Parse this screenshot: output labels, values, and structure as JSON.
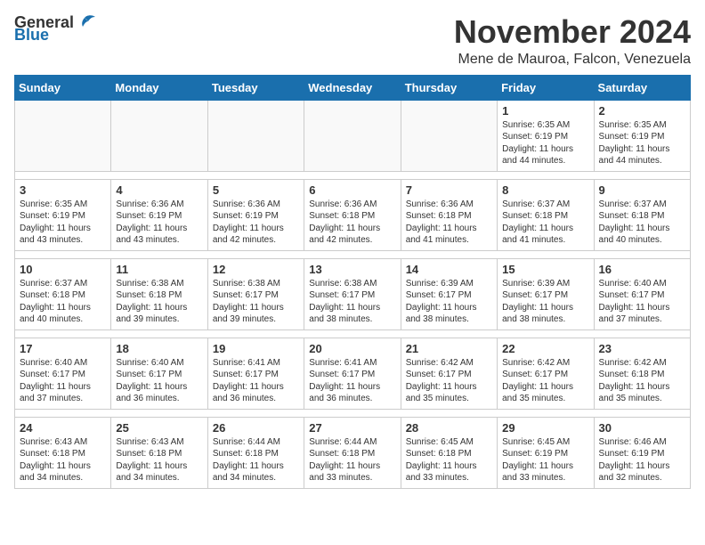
{
  "logo": {
    "general": "General",
    "blue": "Blue"
  },
  "header": {
    "month_title": "November 2024",
    "location": "Mene de Mauroa, Falcon, Venezuela"
  },
  "days_of_week": [
    "Sunday",
    "Monday",
    "Tuesday",
    "Wednesday",
    "Thursday",
    "Friday",
    "Saturday"
  ],
  "weeks": [
    [
      {
        "day": "",
        "info": ""
      },
      {
        "day": "",
        "info": ""
      },
      {
        "day": "",
        "info": ""
      },
      {
        "day": "",
        "info": ""
      },
      {
        "day": "",
        "info": ""
      },
      {
        "day": "1",
        "info": "Sunrise: 6:35 AM\nSunset: 6:19 PM\nDaylight: 11 hours and 44 minutes."
      },
      {
        "day": "2",
        "info": "Sunrise: 6:35 AM\nSunset: 6:19 PM\nDaylight: 11 hours and 44 minutes."
      }
    ],
    [
      {
        "day": "3",
        "info": "Sunrise: 6:35 AM\nSunset: 6:19 PM\nDaylight: 11 hours and 43 minutes."
      },
      {
        "day": "4",
        "info": "Sunrise: 6:36 AM\nSunset: 6:19 PM\nDaylight: 11 hours and 43 minutes."
      },
      {
        "day": "5",
        "info": "Sunrise: 6:36 AM\nSunset: 6:19 PM\nDaylight: 11 hours and 42 minutes."
      },
      {
        "day": "6",
        "info": "Sunrise: 6:36 AM\nSunset: 6:18 PM\nDaylight: 11 hours and 42 minutes."
      },
      {
        "day": "7",
        "info": "Sunrise: 6:36 AM\nSunset: 6:18 PM\nDaylight: 11 hours and 41 minutes."
      },
      {
        "day": "8",
        "info": "Sunrise: 6:37 AM\nSunset: 6:18 PM\nDaylight: 11 hours and 41 minutes."
      },
      {
        "day": "9",
        "info": "Sunrise: 6:37 AM\nSunset: 6:18 PM\nDaylight: 11 hours and 40 minutes."
      }
    ],
    [
      {
        "day": "10",
        "info": "Sunrise: 6:37 AM\nSunset: 6:18 PM\nDaylight: 11 hours and 40 minutes."
      },
      {
        "day": "11",
        "info": "Sunrise: 6:38 AM\nSunset: 6:18 PM\nDaylight: 11 hours and 39 minutes."
      },
      {
        "day": "12",
        "info": "Sunrise: 6:38 AM\nSunset: 6:17 PM\nDaylight: 11 hours and 39 minutes."
      },
      {
        "day": "13",
        "info": "Sunrise: 6:38 AM\nSunset: 6:17 PM\nDaylight: 11 hours and 38 minutes."
      },
      {
        "day": "14",
        "info": "Sunrise: 6:39 AM\nSunset: 6:17 PM\nDaylight: 11 hours and 38 minutes."
      },
      {
        "day": "15",
        "info": "Sunrise: 6:39 AM\nSunset: 6:17 PM\nDaylight: 11 hours and 38 minutes."
      },
      {
        "day": "16",
        "info": "Sunrise: 6:40 AM\nSunset: 6:17 PM\nDaylight: 11 hours and 37 minutes."
      }
    ],
    [
      {
        "day": "17",
        "info": "Sunrise: 6:40 AM\nSunset: 6:17 PM\nDaylight: 11 hours and 37 minutes."
      },
      {
        "day": "18",
        "info": "Sunrise: 6:40 AM\nSunset: 6:17 PM\nDaylight: 11 hours and 36 minutes."
      },
      {
        "day": "19",
        "info": "Sunrise: 6:41 AM\nSunset: 6:17 PM\nDaylight: 11 hours and 36 minutes."
      },
      {
        "day": "20",
        "info": "Sunrise: 6:41 AM\nSunset: 6:17 PM\nDaylight: 11 hours and 36 minutes."
      },
      {
        "day": "21",
        "info": "Sunrise: 6:42 AM\nSunset: 6:17 PM\nDaylight: 11 hours and 35 minutes."
      },
      {
        "day": "22",
        "info": "Sunrise: 6:42 AM\nSunset: 6:17 PM\nDaylight: 11 hours and 35 minutes."
      },
      {
        "day": "23",
        "info": "Sunrise: 6:42 AM\nSunset: 6:18 PM\nDaylight: 11 hours and 35 minutes."
      }
    ],
    [
      {
        "day": "24",
        "info": "Sunrise: 6:43 AM\nSunset: 6:18 PM\nDaylight: 11 hours and 34 minutes."
      },
      {
        "day": "25",
        "info": "Sunrise: 6:43 AM\nSunset: 6:18 PM\nDaylight: 11 hours and 34 minutes."
      },
      {
        "day": "26",
        "info": "Sunrise: 6:44 AM\nSunset: 6:18 PM\nDaylight: 11 hours and 34 minutes."
      },
      {
        "day": "27",
        "info": "Sunrise: 6:44 AM\nSunset: 6:18 PM\nDaylight: 11 hours and 33 minutes."
      },
      {
        "day": "28",
        "info": "Sunrise: 6:45 AM\nSunset: 6:18 PM\nDaylight: 11 hours and 33 minutes."
      },
      {
        "day": "29",
        "info": "Sunrise: 6:45 AM\nSunset: 6:19 PM\nDaylight: 11 hours and 33 minutes."
      },
      {
        "day": "30",
        "info": "Sunrise: 6:46 AM\nSunset: 6:19 PM\nDaylight: 11 hours and 32 minutes."
      }
    ]
  ]
}
